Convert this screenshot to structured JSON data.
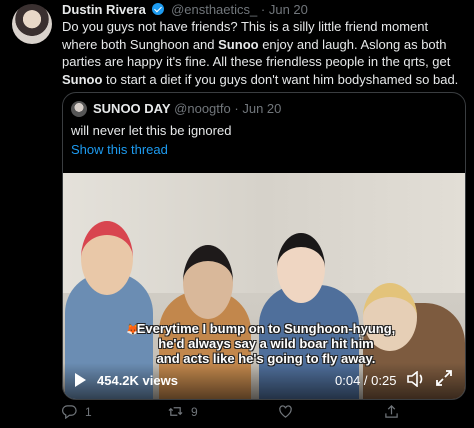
{
  "tweet": {
    "author_name": "Dustin Rivera",
    "author_handle": "@ensthaetics_",
    "separator": "·",
    "date": "Jun 20",
    "text_parts": {
      "p1": "Do you guys not have friends? This is a silly little friend moment where both Sunghoon and ",
      "p2": "Sunoo",
      "p3": " enjoy and laugh. Aslong as both parties are happy it's fine. All these friendless people in the qrts, get ",
      "p4": "Sunoo",
      "p5": " to start a diet if you guys don't want him bodyshamed so bad."
    }
  },
  "quote": {
    "author_name": "SUNOO DAY",
    "author_handle": "@noogtfo",
    "separator": "·",
    "date": "Jun 20",
    "text": "will never let this be ignored",
    "show_thread": "Show this thread",
    "video": {
      "subtitle_line1": "Everytime I bump on to Sunghoon-hyung,",
      "subtitle_line2": "he'd always say a wild boar hit him",
      "subtitle_line3": "and acts like he's going to fly away.",
      "views": "454.2K views",
      "time": "0:04 / 0:25"
    }
  },
  "actions": {
    "reply_count": "1",
    "retweet_count": "9",
    "like_count": "",
    "share_count": ""
  },
  "colors": {
    "background": "#000000",
    "text": "#e7e9ea",
    "muted": "#71767b",
    "accent": "#1d9bf0"
  },
  "icons": [
    "verified-badge-icon",
    "play-icon",
    "volume-icon",
    "expand-icon",
    "reply-icon",
    "retweet-icon",
    "like-icon",
    "share-icon"
  ]
}
